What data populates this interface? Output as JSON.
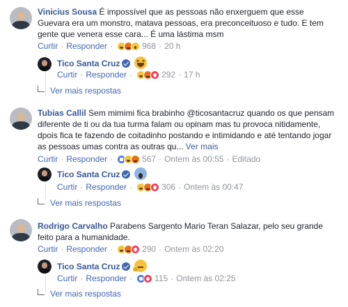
{
  "comments": [
    {
      "author": "Vinicius Sousa",
      "text": "É impossível que as pessoas não enxerguem que esse Guevara era um monstro, matava pessoas, era preconceituoso e tudo. E tem gente que venera esse cara... É uma lástima msm",
      "actions": {
        "like": "Curtir",
        "reply": "Responder",
        "reactions": [
          "haha",
          "angry",
          "wow"
        ],
        "count": "968",
        "time": "20 h"
      },
      "reply": {
        "author": "Tico Santa Cruz",
        "emoji": "laugh",
        "actions": {
          "like": "Curtir",
          "reply": "Responder",
          "reactions": [
            "haha",
            "angry",
            "love"
          ],
          "count": "292",
          "time": "17 h"
        }
      },
      "more_replies": "Ver mais respostas"
    },
    {
      "author": "Tubias Callil",
      "text": "Sem mimimi fica brabinho @ticosantacruz quando os que pensam diferente de ti ou da tua turma falam ou opinam mas tu provoca nitidamente, dpois fica te fazendo de coitadinho postando e intimidando e até tentando jogar as pessoas umas contra as outras qu...",
      "see_more": "Ver mais",
      "actions": {
        "like": "Curtir",
        "reply": "Responder",
        "reactions": [
          "like",
          "haha",
          "angry"
        ],
        "count": "567",
        "time": "Ontem às 00:55",
        "edited": "Editado"
      },
      "reply": {
        "author": "Tico Santa Cruz",
        "emoji": "scream",
        "actions": {
          "like": "Curtir",
          "reply": "Responder",
          "reactions": [
            "haha",
            "angry",
            "love"
          ],
          "count": "306",
          "time": "Ontem às 00:47"
        }
      },
      "more_replies": "Ver mais respostas"
    },
    {
      "author": "Rodrigo Carvalho",
      "text": "Parabens Sargento Mario Teran Salazar, pelo seu grande feito para a humanidade.",
      "actions": {
        "like": "Curtir",
        "reply": "Responder",
        "reactions": [
          "haha",
          "angry",
          "love"
        ],
        "count": "290",
        "time": "Ontem às 02:20"
      },
      "reply": {
        "author": "Tico Santa Cruz",
        "emoji": "think",
        "actions": {
          "like": "Curtir",
          "reply": "Responder",
          "reactions": [
            "like",
            "love"
          ],
          "count": "115",
          "time": "Ontem às 02:25"
        }
      },
      "more_replies": "Ver mais respostas"
    }
  ],
  "colors": {
    "link": "#365899",
    "action": "#4267b2",
    "meta": "#90949c",
    "text": "#1d2129"
  }
}
